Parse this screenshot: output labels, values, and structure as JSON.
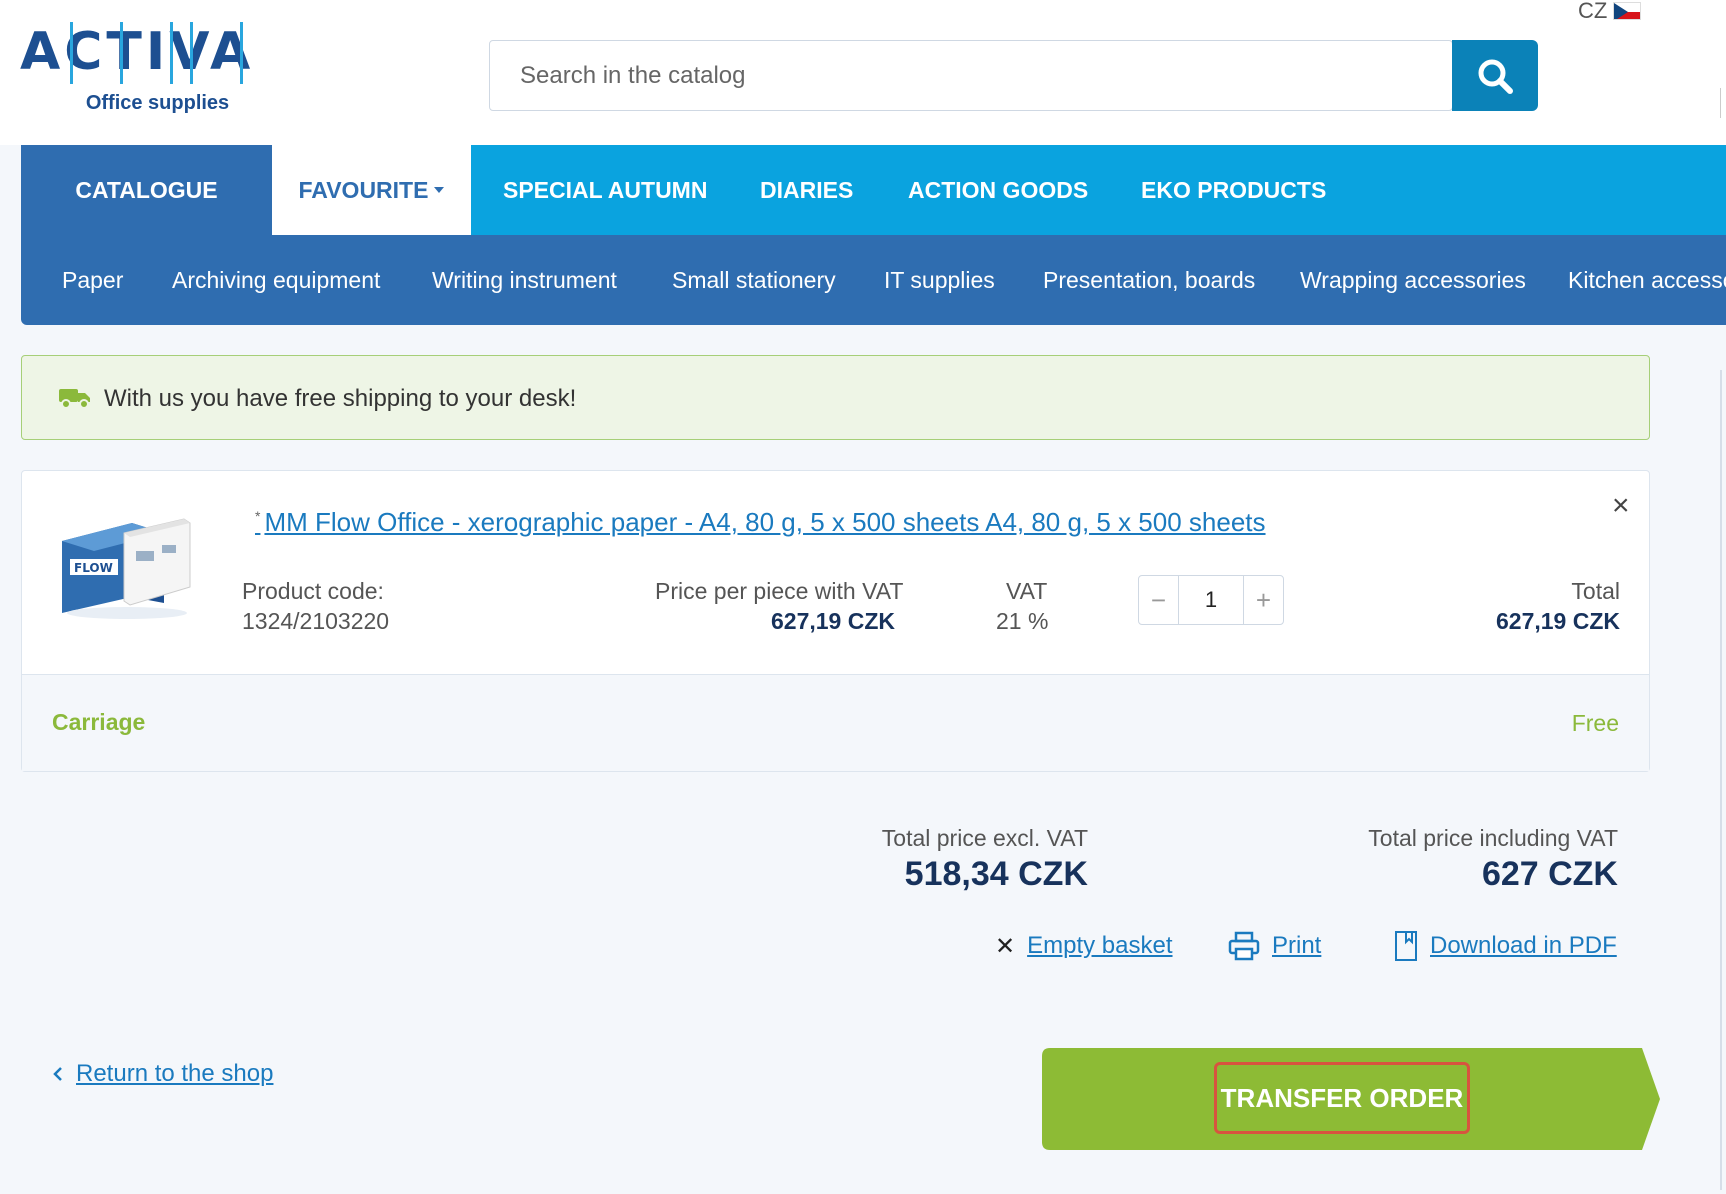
{
  "header": {
    "logo": {
      "wordmark": "ACTIVA",
      "subtitle": "Office supplies"
    },
    "search": {
      "placeholder": "Search in the catalog",
      "icon": "search-icon"
    },
    "language": {
      "code": "CZ",
      "flag": "czech-flag-icon"
    }
  },
  "main_nav": {
    "items": [
      {
        "label": "CATALOGUE"
      },
      {
        "label": "FAVOURITE"
      },
      {
        "label": "SPECIAL AUTUMN"
      },
      {
        "label": "DIARIES"
      },
      {
        "label": "ACTION GOODS"
      },
      {
        "label": "EKO PRODUCTS"
      }
    ]
  },
  "sub_nav": {
    "items": [
      {
        "label": "Paper"
      },
      {
        "label": "Archiving equipment"
      },
      {
        "label": "Writing instrument"
      },
      {
        "label": "Small stationery"
      },
      {
        "label": "IT supplies"
      },
      {
        "label": "Presentation, boards"
      },
      {
        "label": "Wrapping accessories"
      },
      {
        "label": "Kitchen accesso"
      }
    ]
  },
  "shipping_banner": {
    "text": "With us you have free shipping to your desk!",
    "icon": "truck-icon"
  },
  "cart": {
    "item": {
      "marker": "*",
      "name": "MM Flow Office - xerographic paper - A4, 80 g, 5 x 500 sheets A4, 80 g, 5 x 500 sheets",
      "product_code_label": "Product code:",
      "product_code": "1324/2103220",
      "price_label": "Price per piece with VAT",
      "price": "627,19 CZK",
      "vat_label": "VAT",
      "vat": "21 %",
      "quantity": "1",
      "total_label": "Total",
      "total": "627,19 CZK"
    },
    "carriage": {
      "label": "Carriage",
      "value": "Free"
    }
  },
  "totals": {
    "excl_label": "Total price excl. VAT",
    "excl_value": "518,34 CZK",
    "incl_label": "Total price including VAT",
    "incl_value": "627 CZK"
  },
  "actions": {
    "empty_basket": "Empty basket",
    "print": "Print",
    "download_pdf": "Download in PDF"
  },
  "footer": {
    "return_link": "Return to the shop",
    "transfer_button": "TRANSFER ORDER"
  },
  "colors": {
    "nav_blue": "#0aa3df",
    "nav_dark": "#2f6db0",
    "brand_green": "#8dbb35",
    "link_blue": "#1a7abf",
    "highlight_red": "#d8543f"
  }
}
